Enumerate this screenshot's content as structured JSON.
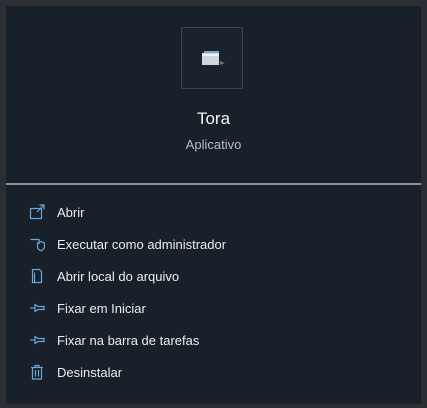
{
  "app": {
    "name": "Tora",
    "type": "Aplicativo",
    "icon": "folder-app-icon"
  },
  "menu": {
    "items": [
      {
        "label": "Abrir",
        "icon": "open-external-icon"
      },
      {
        "label": "Executar como administrador",
        "icon": "shield-icon"
      },
      {
        "label": "Abrir local do arquivo",
        "icon": "file-location-icon"
      },
      {
        "label": "Fixar em Iniciar",
        "icon": "pin-icon"
      },
      {
        "label": "Fixar na barra de tarefas",
        "icon": "pin-icon"
      },
      {
        "label": "Desinstalar",
        "icon": "trash-icon"
      }
    ]
  },
  "colors": {
    "panel_bg": "#182129",
    "icon_accent": "#6aa6d8"
  }
}
